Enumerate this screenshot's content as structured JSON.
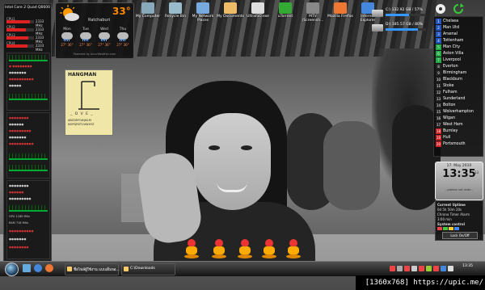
{
  "cpu": {
    "title": "Intel Core 2 Quad Q6600",
    "cores": [
      {
        "label": "CPU1",
        "mhz": "2333 MHz",
        "load": 0.85
      },
      {
        "label": "CPU2",
        "mhz": "2333 MHz",
        "load": 0.7
      },
      {
        "label": "CPU3",
        "mhz": "2333 MHz",
        "load": 0.8
      },
      {
        "label": "CPU4",
        "mhz": "2333 MHz",
        "load": 0.75
      }
    ],
    "gpu_mhz": "1180 MHz",
    "ram_mhz": "718 MHz"
  },
  "weather": {
    "temp": "33°",
    "city": "Ratchaburi",
    "days": [
      {
        "day": "Mon",
        "temps": "27° 36°"
      },
      {
        "day": "Tue",
        "temps": "27° 36°"
      },
      {
        "day": "Wed",
        "temps": "27° 36°"
      },
      {
        "day": "Thu",
        "temps": "27° 36°"
      }
    ],
    "credit": "Powered by AccuWeather.com"
  },
  "desktop_icons": [
    {
      "label": "My Computer",
      "color": "#8ab"
    },
    {
      "label": "Recycle Bin",
      "color": "#9bc"
    },
    {
      "label": "My Network Places",
      "color": "#7ad"
    },
    {
      "label": "My Documents",
      "color": "#eb6"
    },
    {
      "label": "UltraISO.exe",
      "color": "#ddd"
    },
    {
      "label": "uTorrent",
      "color": "#3a3"
    },
    {
      "label": "MTV (Screensh...",
      "color": "#888"
    },
    {
      "label": "Mozilla Firefox",
      "color": "#e73"
    },
    {
      "label": "Internet Explorer",
      "color": "#48d"
    }
  ],
  "drives": [
    {
      "name": "C:\\",
      "info": "132.92 GB / 57%",
      "fill": 0.57
    },
    {
      "name": "D:\\",
      "info": "185.57 GB / 80%",
      "fill": 0.8
    }
  ],
  "league": {
    "teams": [
      {
        "pos": "1",
        "name": "Chelsea",
        "color": "#2255bb"
      },
      {
        "pos": "2",
        "name": "Man Utd",
        "color": "#2255bb"
      },
      {
        "pos": "3",
        "name": "Arsenal",
        "color": "#2255bb"
      },
      {
        "pos": "4",
        "name": "Tottenham",
        "color": "#2255bb"
      },
      {
        "pos": "5",
        "name": "Man City",
        "color": "#22aa44"
      },
      {
        "pos": "6",
        "name": "Aston Villa",
        "color": "#22aa44"
      },
      {
        "pos": "7",
        "name": "Liverpool",
        "color": "#22aa44"
      },
      {
        "pos": "8",
        "name": "Everton",
        "color": "#222222"
      },
      {
        "pos": "9",
        "name": "Birmingham",
        "color": "#222222"
      },
      {
        "pos": "10",
        "name": "Blackburn",
        "color": "#222222"
      },
      {
        "pos": "11",
        "name": "Stoke",
        "color": "#222222"
      },
      {
        "pos": "12",
        "name": "Fulham",
        "color": "#222222"
      },
      {
        "pos": "13",
        "name": "Sunderland",
        "color": "#222222"
      },
      {
        "pos": "14",
        "name": "Bolton",
        "color": "#222222"
      },
      {
        "pos": "15",
        "name": "Wolverhampton",
        "color": "#222222"
      },
      {
        "pos": "16",
        "name": "Wigan",
        "color": "#222222"
      },
      {
        "pos": "17",
        "name": "West Ham",
        "color": "#222222"
      },
      {
        "pos": "18",
        "name": "Burnley",
        "color": "#cc2222"
      },
      {
        "pos": "19",
        "name": "Hull",
        "color": "#cc2222"
      },
      {
        "pos": "20",
        "name": "Portsmouth",
        "color": "#cc2222"
      }
    ]
  },
  "clock": {
    "date": "17. May 2010",
    "time": "13:35",
    "seconds": "13",
    "message": "..please set date.."
  },
  "sysctl": {
    "uptime_label": "Current Uptime",
    "uptime_value": "0d 5h 50m 20s",
    "tabs": "Chrono  Timer  Alarm",
    "timer": "3:00 min",
    "title": "System control",
    "lock": "Lock On/Off"
  },
  "hangman": {
    "title": "HANGMAN",
    "word": "_ O V E _",
    "letters": "ABCDEFGHIJKLM NOPQRSTUVWXYZ"
  },
  "taskbar": {
    "tasks": [
      {
        "label": "ชื่อไฟล์ผู้ใช้งาน แบบเต็มจอ..."
      },
      {
        "label": "C:\\Downloads"
      }
    ],
    "tray_time": "13:35"
  },
  "watermark": "[1360x768] https://upic.me/"
}
